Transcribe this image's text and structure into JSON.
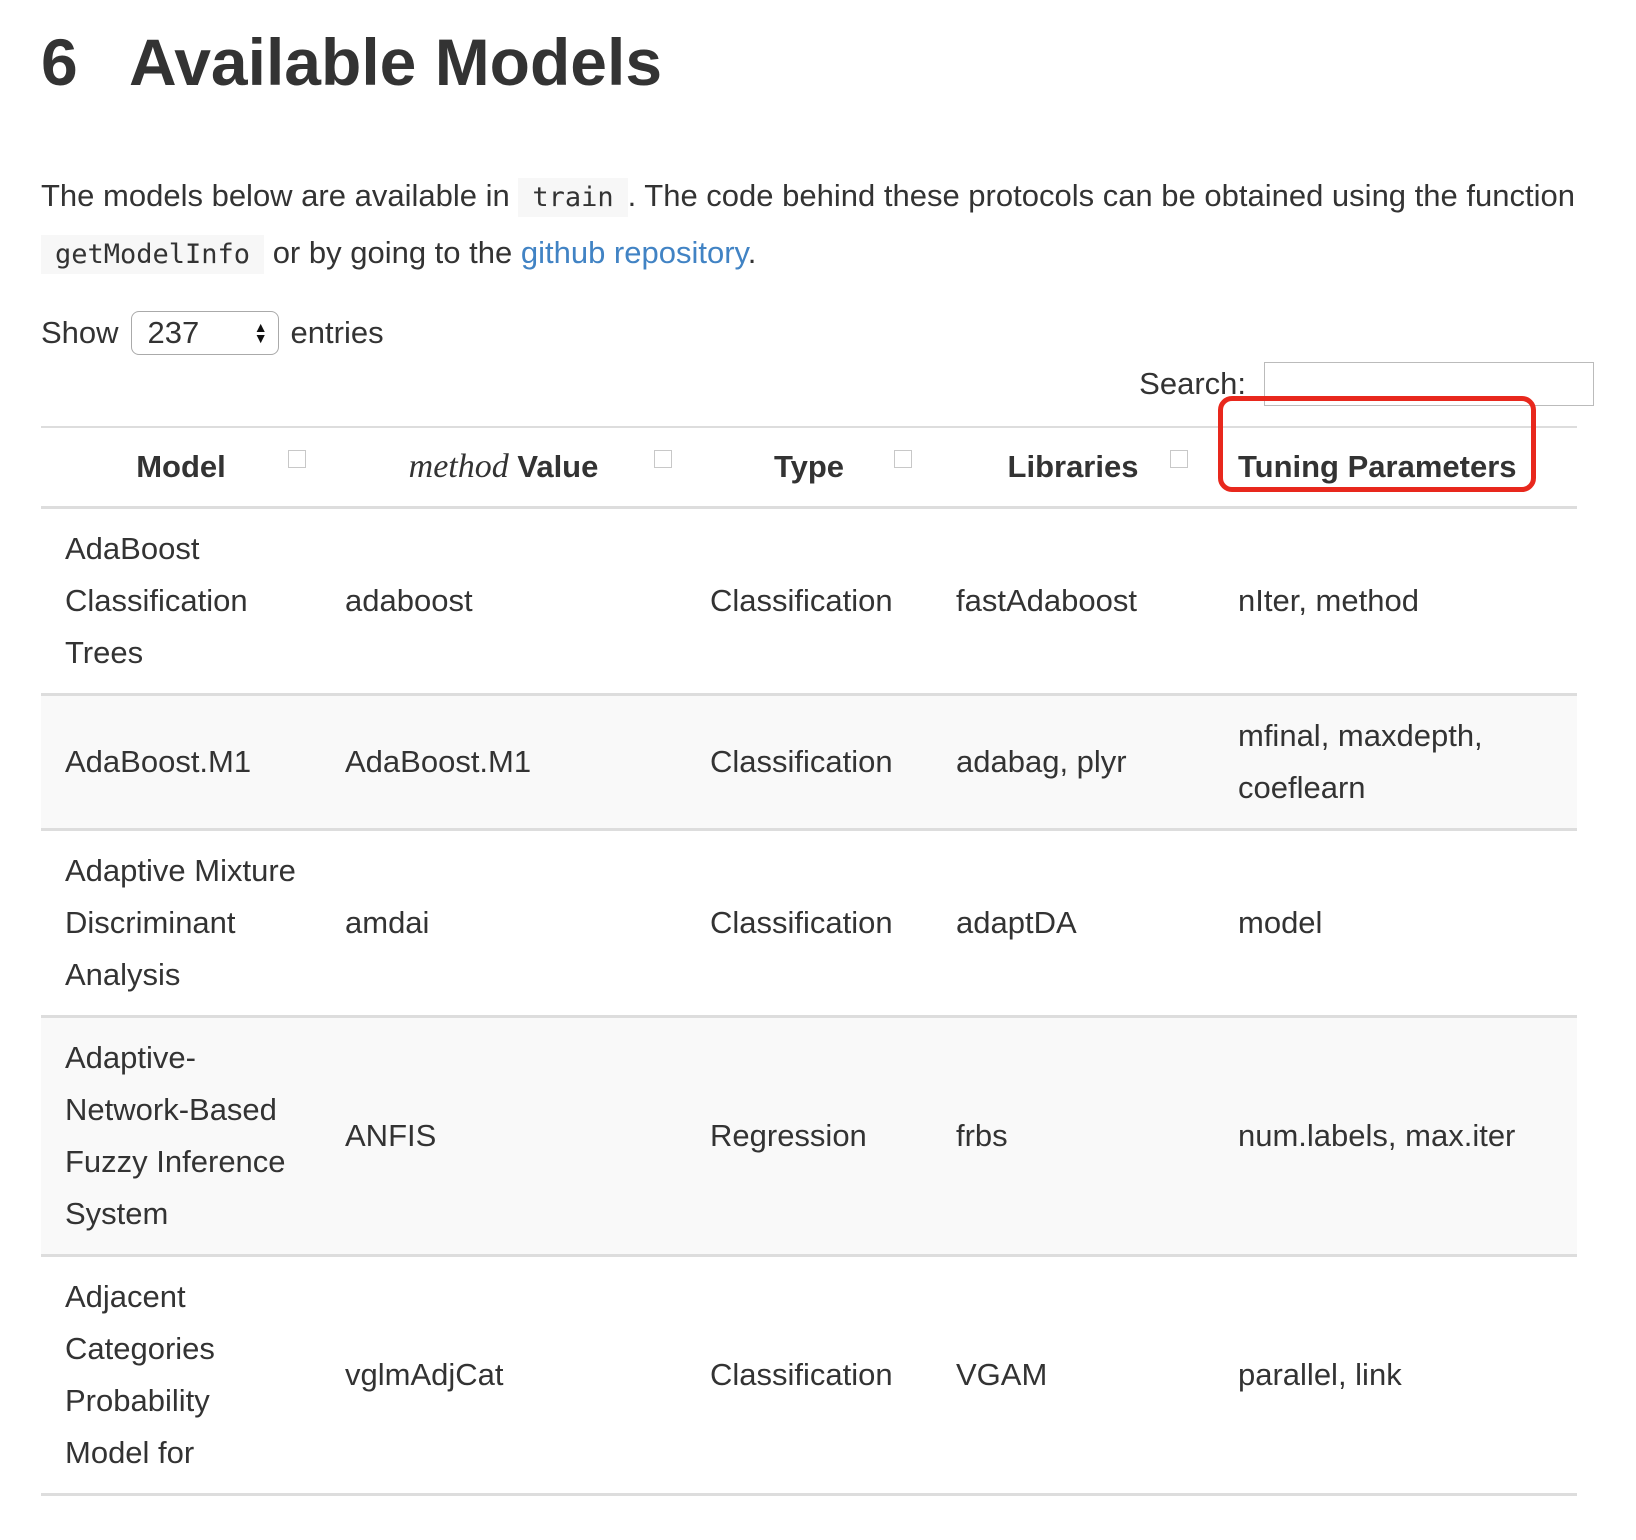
{
  "title": {
    "number": "6",
    "text": "Available Models"
  },
  "intro": {
    "before_train": "The models below are available in ",
    "train_code": "train",
    "after_train": ". The code behind these protocols can be obtained using the function ",
    "getmodelinfo_code": "getModelInfo",
    "after_code": " or by going to the ",
    "link_text": "github repository",
    "end": "."
  },
  "length_control": {
    "show_label": "Show",
    "selected": "237",
    "entries_label": "entries"
  },
  "search": {
    "label": "Search:",
    "value": ""
  },
  "table": {
    "headers": {
      "model": "Model",
      "method_italic": "method",
      "method_rest": "Value",
      "type": "Type",
      "libraries": "Libraries",
      "tuning": "Tuning Parameters"
    },
    "rows": [
      {
        "model": "AdaBoost Classification Trees",
        "method": "adaboost",
        "type": "Classification",
        "libraries": "fastAdaboost",
        "tuning": "nIter, method"
      },
      {
        "model": "AdaBoost.M1",
        "method": "AdaBoost.M1",
        "type": "Classification",
        "libraries": "adabag, plyr",
        "tuning": "mfinal, maxdepth, coeflearn"
      },
      {
        "model": "Adaptive Mixture Discriminant Analysis",
        "method": "amdai",
        "type": "Classification",
        "libraries": "adaptDA",
        "tuning": "model"
      },
      {
        "model": "Adaptive-Network-Based Fuzzy Inference System",
        "method": "ANFIS",
        "type": "Regression",
        "libraries": "frbs",
        "tuning": "num.labels, max.iter"
      },
      {
        "model": "Adjacent Categories Probability Model for",
        "method": "vglmAdjCat",
        "type": "Classification",
        "libraries": "VGAM",
        "tuning": "parallel, link"
      }
    ]
  },
  "colors": {
    "link": "#4183c4",
    "highlight": "#e8281d",
    "text": "#333333"
  }
}
